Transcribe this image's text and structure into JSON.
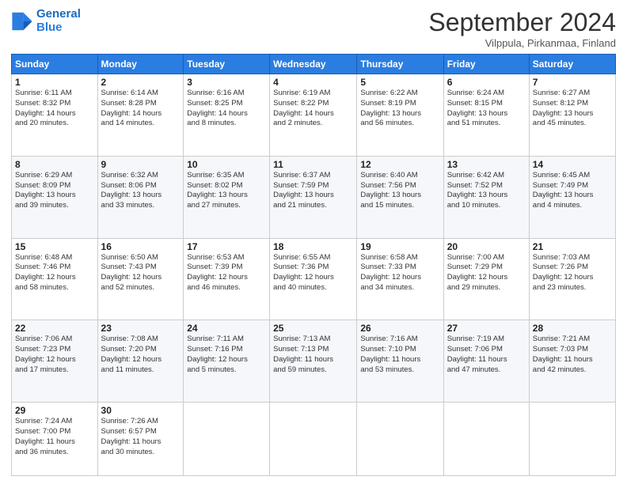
{
  "header": {
    "logo_line1": "General",
    "logo_line2": "Blue",
    "month": "September 2024",
    "location": "Vilppula, Pirkanmaa, Finland"
  },
  "weekdays": [
    "Sunday",
    "Monday",
    "Tuesday",
    "Wednesday",
    "Thursday",
    "Friday",
    "Saturday"
  ],
  "weeks": [
    [
      {
        "day": "1",
        "info": "Sunrise: 6:11 AM\nSunset: 8:32 PM\nDaylight: 14 hours\nand 20 minutes."
      },
      {
        "day": "2",
        "info": "Sunrise: 6:14 AM\nSunset: 8:28 PM\nDaylight: 14 hours\nand 14 minutes."
      },
      {
        "day": "3",
        "info": "Sunrise: 6:16 AM\nSunset: 8:25 PM\nDaylight: 14 hours\nand 8 minutes."
      },
      {
        "day": "4",
        "info": "Sunrise: 6:19 AM\nSunset: 8:22 PM\nDaylight: 14 hours\nand 2 minutes."
      },
      {
        "day": "5",
        "info": "Sunrise: 6:22 AM\nSunset: 8:19 PM\nDaylight: 13 hours\nand 56 minutes."
      },
      {
        "day": "6",
        "info": "Sunrise: 6:24 AM\nSunset: 8:15 PM\nDaylight: 13 hours\nand 51 minutes."
      },
      {
        "day": "7",
        "info": "Sunrise: 6:27 AM\nSunset: 8:12 PM\nDaylight: 13 hours\nand 45 minutes."
      }
    ],
    [
      {
        "day": "8",
        "info": "Sunrise: 6:29 AM\nSunset: 8:09 PM\nDaylight: 13 hours\nand 39 minutes."
      },
      {
        "day": "9",
        "info": "Sunrise: 6:32 AM\nSunset: 8:06 PM\nDaylight: 13 hours\nand 33 minutes."
      },
      {
        "day": "10",
        "info": "Sunrise: 6:35 AM\nSunset: 8:02 PM\nDaylight: 13 hours\nand 27 minutes."
      },
      {
        "day": "11",
        "info": "Sunrise: 6:37 AM\nSunset: 7:59 PM\nDaylight: 13 hours\nand 21 minutes."
      },
      {
        "day": "12",
        "info": "Sunrise: 6:40 AM\nSunset: 7:56 PM\nDaylight: 13 hours\nand 15 minutes."
      },
      {
        "day": "13",
        "info": "Sunrise: 6:42 AM\nSunset: 7:52 PM\nDaylight: 13 hours\nand 10 minutes."
      },
      {
        "day": "14",
        "info": "Sunrise: 6:45 AM\nSunset: 7:49 PM\nDaylight: 13 hours\nand 4 minutes."
      }
    ],
    [
      {
        "day": "15",
        "info": "Sunrise: 6:48 AM\nSunset: 7:46 PM\nDaylight: 12 hours\nand 58 minutes."
      },
      {
        "day": "16",
        "info": "Sunrise: 6:50 AM\nSunset: 7:43 PM\nDaylight: 12 hours\nand 52 minutes."
      },
      {
        "day": "17",
        "info": "Sunrise: 6:53 AM\nSunset: 7:39 PM\nDaylight: 12 hours\nand 46 minutes."
      },
      {
        "day": "18",
        "info": "Sunrise: 6:55 AM\nSunset: 7:36 PM\nDaylight: 12 hours\nand 40 minutes."
      },
      {
        "day": "19",
        "info": "Sunrise: 6:58 AM\nSunset: 7:33 PM\nDaylight: 12 hours\nand 34 minutes."
      },
      {
        "day": "20",
        "info": "Sunrise: 7:00 AM\nSunset: 7:29 PM\nDaylight: 12 hours\nand 29 minutes."
      },
      {
        "day": "21",
        "info": "Sunrise: 7:03 AM\nSunset: 7:26 PM\nDaylight: 12 hours\nand 23 minutes."
      }
    ],
    [
      {
        "day": "22",
        "info": "Sunrise: 7:06 AM\nSunset: 7:23 PM\nDaylight: 12 hours\nand 17 minutes."
      },
      {
        "day": "23",
        "info": "Sunrise: 7:08 AM\nSunset: 7:20 PM\nDaylight: 12 hours\nand 11 minutes."
      },
      {
        "day": "24",
        "info": "Sunrise: 7:11 AM\nSunset: 7:16 PM\nDaylight: 12 hours\nand 5 minutes."
      },
      {
        "day": "25",
        "info": "Sunrise: 7:13 AM\nSunset: 7:13 PM\nDaylight: 11 hours\nand 59 minutes."
      },
      {
        "day": "26",
        "info": "Sunrise: 7:16 AM\nSunset: 7:10 PM\nDaylight: 11 hours\nand 53 minutes."
      },
      {
        "day": "27",
        "info": "Sunrise: 7:19 AM\nSunset: 7:06 PM\nDaylight: 11 hours\nand 47 minutes."
      },
      {
        "day": "28",
        "info": "Sunrise: 7:21 AM\nSunset: 7:03 PM\nDaylight: 11 hours\nand 42 minutes."
      }
    ],
    [
      {
        "day": "29",
        "info": "Sunrise: 7:24 AM\nSunset: 7:00 PM\nDaylight: 11 hours\nand 36 minutes."
      },
      {
        "day": "30",
        "info": "Sunrise: 7:26 AM\nSunset: 6:57 PM\nDaylight: 11 hours\nand 30 minutes."
      },
      {
        "day": "",
        "info": ""
      },
      {
        "day": "",
        "info": ""
      },
      {
        "day": "",
        "info": ""
      },
      {
        "day": "",
        "info": ""
      },
      {
        "day": "",
        "info": ""
      }
    ]
  ]
}
